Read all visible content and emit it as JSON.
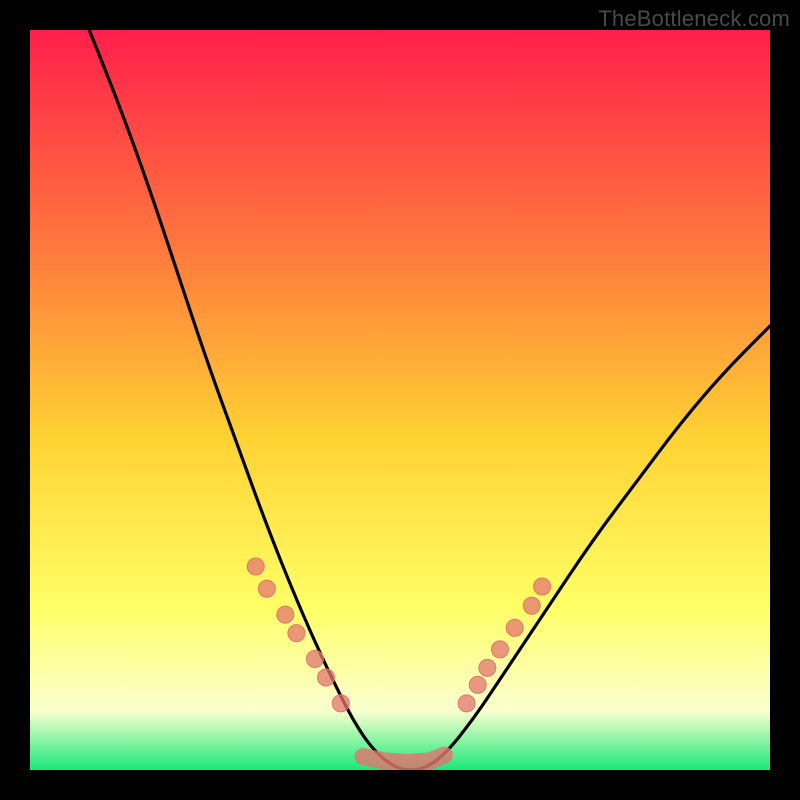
{
  "watermark": "TheBottleneck.com",
  "colors": {
    "bg": "#000000",
    "gradient_top": "#ff1f4b",
    "gradient_mid1": "#ff7a3d",
    "gradient_mid2": "#ffd233",
    "gradient_mid3": "#ffff66",
    "gradient_low": "#faffcf",
    "gradient_bottom": "#19e87a",
    "curve": "#000000",
    "markers": "#e2756f"
  },
  "chart_data": {
    "type": "line",
    "title": "",
    "xlabel": "",
    "ylabel": "",
    "xlim": [
      0,
      1
    ],
    "ylim": [
      0,
      1
    ],
    "legend": false,
    "curve": {
      "x": [
        0.08,
        0.12,
        0.16,
        0.2,
        0.24,
        0.28,
        0.32,
        0.36,
        0.4,
        0.44,
        0.47,
        0.5,
        0.53,
        0.56,
        0.6,
        0.64,
        0.7,
        0.76,
        0.82,
        0.88,
        0.94,
        1.0
      ],
      "y": [
        1.0,
        0.9,
        0.79,
        0.67,
        0.55,
        0.44,
        0.33,
        0.23,
        0.14,
        0.06,
        0.02,
        0.0,
        0.0,
        0.02,
        0.07,
        0.13,
        0.22,
        0.31,
        0.39,
        0.47,
        0.54,
        0.6
      ]
    },
    "markers_left": {
      "x": [
        0.305,
        0.32,
        0.345,
        0.36,
        0.385,
        0.4,
        0.42
      ],
      "y": [
        0.275,
        0.245,
        0.21,
        0.185,
        0.15,
        0.125,
        0.09
      ]
    },
    "markers_right": {
      "x": [
        0.59,
        0.605,
        0.618,
        0.635,
        0.655,
        0.678,
        0.692
      ],
      "y": [
        0.09,
        0.115,
        0.138,
        0.163,
        0.192,
        0.222,
        0.248
      ]
    },
    "plateau": {
      "x": [
        0.45,
        0.48,
        0.51,
        0.54,
        0.56
      ],
      "y": [
        0.01,
        0.004,
        0.002,
        0.004,
        0.012
      ]
    }
  }
}
